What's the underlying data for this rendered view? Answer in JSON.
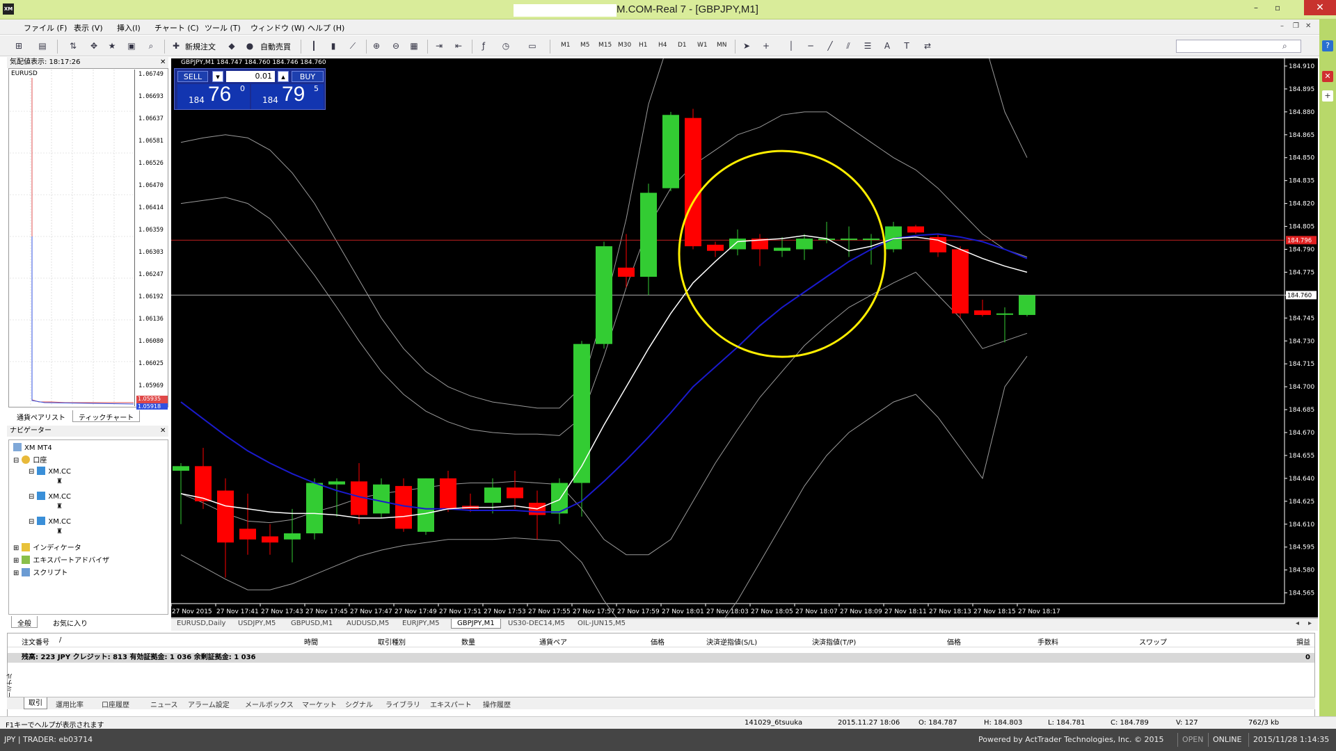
{
  "window": {
    "title": "M.COM-Real 7 - [GBPJPY,M1]",
    "logo": "XM",
    "controls": [
      "–",
      "▫",
      "✕"
    ]
  },
  "menu": [
    "ファイル (F)",
    "表示 (V)",
    "挿入(I)",
    "チャート (C)",
    "ツール (T)",
    "ウィンドウ (W)",
    "ヘルプ (H)"
  ],
  "toolbar": {
    "new_order": "新規注文",
    "auto_trade": "自動売買",
    "timeframes": [
      "M1",
      "M5",
      "M15",
      "M30",
      "H1",
      "H4",
      "D1",
      "W1",
      "MN"
    ]
  },
  "market_watch": {
    "title": "気配値表示: 18:17:26",
    "symbol": "EURUSD",
    "prices": [
      "1.06749",
      "1.06693",
      "1.06637",
      "1.06581",
      "1.06526",
      "1.06470",
      "1.06414",
      "1.06359",
      "1.06303",
      "1.06247",
      "1.06192",
      "1.06136",
      "1.06080",
      "1.06025",
      "1.05969"
    ],
    "ask_tag": "1.05935",
    "bid_tag": "1.05918",
    "tabs": [
      "通貨ペアリスト",
      "ティックチャート"
    ]
  },
  "navigator": {
    "title": "ナビゲーター",
    "root": "XM MT4",
    "accounts_label": "口座",
    "accounts": [
      "XM.CC",
      "XM.CC",
      "XM.CC"
    ],
    "indicators": "インディケータ",
    "experts": "エキスパートアドバイザ",
    "scripts": "スクリプト",
    "tabs": [
      "全般",
      "お気に入り"
    ]
  },
  "chart": {
    "header": "GBPJPY,M1  184.747 184.760 184.746 184.760",
    "oneclick": {
      "sell": "SELL",
      "buy": "BUY",
      "lot": "0.01",
      "sell_prefix": "184",
      "sell_big": "76",
      "sell_sup": "0",
      "buy_prefix": "184",
      "buy_big": "79",
      "buy_sup": "5"
    },
    "price_labels": [
      "184.910",
      "184.895",
      "184.880",
      "184.865",
      "184.850",
      "184.835",
      "184.820",
      "184.805",
      "184.790",
      "184.775",
      "184.760",
      "184.745",
      "184.730",
      "184.715",
      "184.700",
      "184.685",
      "184.670",
      "184.655",
      "184.640",
      "184.625",
      "184.610",
      "184.595",
      "184.580",
      "184.565"
    ],
    "ask_tag": "184.796",
    "bid_tag": "184.760",
    "time_labels": [
      "27 Nov 2015",
      "27 Nov 17:41",
      "27 Nov 17:43",
      "27 Nov 17:45",
      "27 Nov 17:47",
      "27 Nov 17:49",
      "27 Nov 17:51",
      "27 Nov 17:53",
      "27 Nov 17:55",
      "27 Nov 17:57",
      "27 Nov 17:59",
      "27 Nov 18:01",
      "27 Nov 18:03",
      "27 Nov 18:05",
      "27 Nov 18:07",
      "27 Nov 18:09",
      "27 Nov 18:11",
      "27 Nov 18:13",
      "27 Nov 18:15",
      "27 Nov 18:17"
    ],
    "candles": [
      {
        "o": 184.645,
        "h": 184.65,
        "l": 184.61,
        "c": 184.648
      },
      {
        "o": 184.648,
        "h": 184.66,
        "l": 184.62,
        "c": 184.625
      },
      {
        "o": 184.632,
        "h": 184.64,
        "l": 184.575,
        "c": 184.598
      },
      {
        "o": 184.607,
        "h": 184.63,
        "l": 184.59,
        "c": 184.6
      },
      {
        "o": 184.602,
        "h": 184.61,
        "l": 184.59,
        "c": 184.598
      },
      {
        "o": 184.6,
        "h": 184.62,
        "l": 184.585,
        "c": 184.604
      },
      {
        "o": 184.604,
        "h": 184.64,
        "l": 184.6,
        "c": 184.637
      },
      {
        "o": 184.636,
        "h": 184.64,
        "l": 184.615,
        "c": 184.638
      },
      {
        "o": 184.638,
        "h": 184.65,
        "l": 184.61,
        "c": 184.616
      },
      {
        "o": 184.617,
        "h": 184.64,
        "l": 184.614,
        "c": 184.636
      },
      {
        "o": 184.635,
        "h": 184.64,
        "l": 184.605,
        "c": 184.607
      },
      {
        "o": 184.605,
        "h": 184.64,
        "l": 184.603,
        "c": 184.64
      },
      {
        "o": 184.64,
        "h": 184.645,
        "l": 184.618,
        "c": 184.62
      },
      {
        "o": 184.622,
        "h": 184.63,
        "l": 184.618,
        "c": 184.62
      },
      {
        "o": 184.624,
        "h": 184.64,
        "l": 184.617,
        "c": 184.634
      },
      {
        "o": 184.634,
        "h": 184.645,
        "l": 184.62,
        "c": 184.627
      },
      {
        "o": 184.624,
        "h": 184.632,
        "l": 184.6,
        "c": 184.616
      },
      {
        "o": 184.617,
        "h": 184.64,
        "l": 184.61,
        "c": 184.637
      },
      {
        "o": 184.637,
        "h": 184.73,
        "l": 184.615,
        "c": 184.728
      },
      {
        "o": 184.728,
        "h": 184.795,
        "l": 184.725,
        "c": 184.792
      },
      {
        "o": 184.778,
        "h": 184.8,
        "l": 184.765,
        "c": 184.772
      },
      {
        "o": 184.772,
        "h": 184.833,
        "l": 184.76,
        "c": 184.827
      },
      {
        "o": 184.83,
        "h": 184.88,
        "l": 184.828,
        "c": 184.878
      },
      {
        "o": 184.876,
        "h": 184.882,
        "l": 184.79,
        "c": 184.792
      },
      {
        "o": 184.793,
        "h": 184.795,
        "l": 184.785,
        "c": 184.789
      },
      {
        "o": 184.79,
        "h": 184.803,
        "l": 184.786,
        "c": 184.797
      },
      {
        "o": 184.797,
        "h": 184.8,
        "l": 184.779,
        "c": 184.79
      },
      {
        "o": 184.789,
        "h": 184.798,
        "l": 184.785,
        "c": 184.791
      },
      {
        "o": 184.79,
        "h": 184.8,
        "l": 184.783,
        "c": 184.797
      },
      {
        "o": 184.797,
        "h": 184.808,
        "l": 184.794,
        "c": 184.797
      },
      {
        "o": 184.797,
        "h": 184.805,
        "l": 184.785,
        "c": 184.797
      },
      {
        "o": 184.797,
        "h": 184.8,
        "l": 184.78,
        "c": 184.797
      },
      {
        "o": 184.79,
        "h": 184.808,
        "l": 184.788,
        "c": 184.805
      },
      {
        "o": 184.805,
        "h": 184.806,
        "l": 184.8,
        "c": 184.801
      },
      {
        "o": 184.798,
        "h": 184.8,
        "l": 184.785,
        "c": 184.788
      },
      {
        "o": 184.79,
        "h": 184.792,
        "l": 184.745,
        "c": 184.748
      },
      {
        "o": 184.75,
        "h": 184.757,
        "l": 184.746,
        "c": 184.747
      },
      {
        "o": 184.748,
        "h": 184.752,
        "l": 184.729,
        "c": 184.748
      },
      {
        "o": 184.747,
        "h": 184.76,
        "l": 184.746,
        "c": 184.76
      }
    ],
    "ma_white": [
      184.63,
      184.627,
      184.622,
      184.62,
      184.618,
      184.617,
      184.617,
      184.616,
      184.614,
      184.614,
      184.615,
      184.617,
      184.62,
      184.621,
      184.621,
      184.622,
      184.62,
      184.626,
      184.648,
      184.675,
      184.7,
      184.725,
      184.748,
      184.768,
      184.782,
      184.795,
      184.796,
      184.797,
      184.799,
      184.797,
      184.789,
      184.792,
      184.797,
      184.798,
      184.796,
      184.79,
      184.784,
      184.779,
      184.775
    ],
    "ma_blue": [
      184.69,
      184.679,
      184.668,
      184.658,
      184.65,
      184.643,
      184.637,
      184.632,
      184.628,
      184.625,
      184.622,
      184.62,
      184.62,
      184.619,
      184.619,
      184.619,
      184.618,
      184.618,
      184.625,
      184.638,
      184.652,
      184.667,
      184.683,
      184.7,
      184.713,
      184.726,
      184.74,
      184.752,
      184.762,
      184.772,
      184.782,
      184.79,
      184.797,
      184.799,
      184.8,
      184.798,
      184.795,
      184.79,
      184.784
    ],
    "bb_upper": [
      184.86,
      184.863,
      184.865,
      184.863,
      184.855,
      184.84,
      184.82,
      184.795,
      184.77,
      184.745,
      184.725,
      184.71,
      184.7,
      184.694,
      184.69,
      184.688,
      184.686,
      184.686,
      184.7,
      184.75,
      184.81,
      184.885,
      184.93,
      184.95,
      184.965,
      184.975,
      184.985,
      184.995,
      185.0,
      185.0,
      184.99,
      184.98,
      184.975,
      184.97,
      184.96,
      184.95,
      184.93,
      184.88,
      184.85
    ],
    "bb_lower": [
      184.59,
      184.582,
      184.574,
      184.567,
      184.567,
      184.571,
      184.577,
      184.583,
      184.589,
      184.593,
      184.596,
      184.598,
      184.6,
      184.6,
      184.6,
      184.601,
      184.6,
      184.599,
      184.585,
      184.56,
      184.54,
      184.53,
      184.53,
      184.53,
      184.54,
      184.56,
      184.585,
      184.61,
      184.635,
      184.655,
      184.67,
      184.68,
      184.69,
      184.695,
      184.68,
      184.66,
      184.64,
      184.7,
      184.72
    ],
    "bb_upper2": [
      184.82,
      184.822,
      184.824,
      184.82,
      184.81,
      184.792,
      184.773,
      184.752,
      184.73,
      184.71,
      184.695,
      184.684,
      184.677,
      184.672,
      184.67,
      184.669,
      184.669,
      184.668,
      184.68,
      184.72,
      184.765,
      184.805,
      184.83,
      184.845,
      184.855,
      184.865,
      184.87,
      184.878,
      184.88,
      184.88,
      184.87,
      184.86,
      184.85,
      184.842,
      184.83,
      184.815,
      184.8,
      184.79,
      184.785
    ],
    "bb_lower2": [
      184.63,
      184.624,
      184.617,
      184.612,
      184.611,
      184.613,
      184.618,
      184.622,
      184.627,
      184.63,
      184.632,
      184.634,
      184.636,
      184.637,
      184.637,
      184.638,
      184.637,
      184.636,
      184.62,
      184.6,
      184.59,
      184.59,
      184.6,
      184.625,
      184.65,
      184.672,
      184.693,
      184.71,
      184.727,
      184.74,
      184.752,
      184.76,
      184.768,
      184.775,
      184.76,
      184.745,
      184.725,
      184.73,
      184.735
    ],
    "price_max": 184.915,
    "price_min": 184.558
  },
  "chart_tabs": [
    "EURUSD,Daily",
    "USDJPY,M5",
    "GBPUSD,M1",
    "AUDUSD,M5",
    "EURJPY,M5",
    "GBPJPY,M1",
    "US30-DEC14,M5",
    "OIL-JUN15,M5"
  ],
  "terminal": {
    "side_label": "ターミナル",
    "columns": [
      "注文番号",
      "/",
      "時間",
      "取引種別",
      "数量",
      "通貨ペア",
      "価格",
      "決済逆指値(S/L)",
      "決済指値(T/P)",
      "価格",
      "手数料",
      "スワップ",
      "損益"
    ],
    "balance": "残高: 223 JPY  クレジット: 813  有効証拠金: 1 036  余剰証拠金: 1 036",
    "balance_value": "0",
    "tabs": [
      "取引",
      "運用比率",
      "口座履歴",
      "ニュース",
      "アラーム設定",
      "メールボックス",
      "マーケット",
      "シグナル",
      "ライブラリ",
      "エキスパート",
      "操作履歴"
    ]
  },
  "status": {
    "help": "F1キーでヘルプが表示されます",
    "profile": "141029_6tsuuka",
    "datetime": "2015.11.27 18:06",
    "open": "O: 184.787",
    "high": "H: 184.803",
    "low": "L: 184.781",
    "close": "C: 184.789",
    "volume": "V: 127",
    "traffic": "762/3 kb"
  },
  "taskbar": {
    "left": "JPY | TRADER: eb03714",
    "powered": "Powered by ActTrader Technologies, Inc. © 2015",
    "open": "OPEN",
    "online": "ONLINE",
    "clock": "2015/11/28 1:14:35"
  },
  "colors": {
    "bull": "#33cc33",
    "bear": "#ff0000",
    "ma_white": "#ffffff",
    "ma_blue": "#1a1acc",
    "bands": "#9a9a9a",
    "highlight_circle": "#ffee00"
  }
}
